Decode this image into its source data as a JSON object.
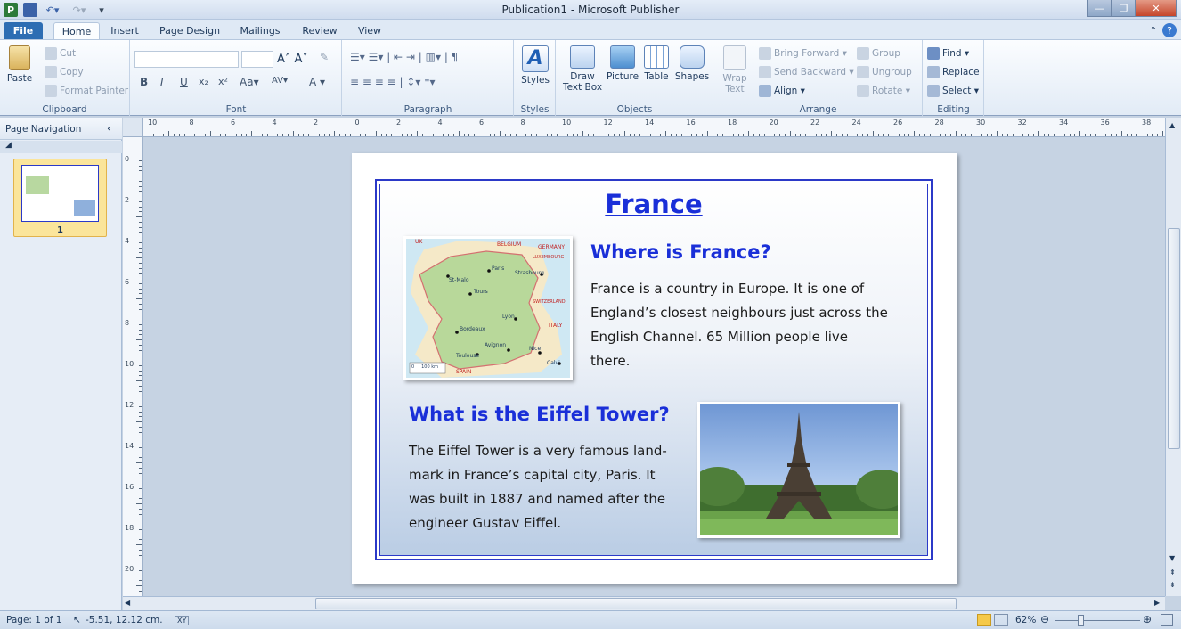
{
  "window": {
    "title": "Publication1 - Microsoft Publisher"
  },
  "tabs": [
    "File",
    "Home",
    "Insert",
    "Page Design",
    "Mailings",
    "Review",
    "View"
  ],
  "ribbon": {
    "clipboard": {
      "paste": "Paste",
      "cut": "Cut",
      "copy": "Copy",
      "format_painter": "Format Painter",
      "label": "Clipboard"
    },
    "font": {
      "label": "Font"
    },
    "paragraph": {
      "label": "Paragraph"
    },
    "styles": {
      "button": "Styles",
      "label": "Styles"
    },
    "objects": {
      "draw_text_box_1": "Draw",
      "draw_text_box_2": "Text Box",
      "picture": "Picture",
      "table": "Table",
      "shapes": "Shapes",
      "label": "Objects"
    },
    "arrange": {
      "wrap_1": "Wrap",
      "wrap_2": "Text",
      "bring_forward": "Bring Forward",
      "send_backward": "Send Backward",
      "align": "Align",
      "group": "Group",
      "ungroup": "Ungroup",
      "rotate": "Rotate",
      "label": "Arrange"
    },
    "editing": {
      "find": "Find",
      "replace": "Replace",
      "select": "Select",
      "label": "Editing"
    }
  },
  "nav": {
    "title": "Page Navigation",
    "page_number": "1"
  },
  "ruler": {
    "h_ticks": [
      "10",
      "8",
      "6",
      "4",
      "2",
      "0",
      "2",
      "4",
      "6",
      "8",
      "10",
      "12",
      "14",
      "16",
      "18",
      "20",
      "22",
      "24",
      "26",
      "28",
      "30",
      "32",
      "34",
      "36",
      "38"
    ],
    "v_ticks": [
      "0",
      "2",
      "4",
      "6",
      "8",
      "10",
      "12",
      "14",
      "16",
      "18",
      "20"
    ]
  },
  "document": {
    "title": "France",
    "heading1": "Where is France?",
    "paragraph1": [
      "France is a country in Europe. It is  one of",
      "England’s closest neighbours just across the",
      "English Channel. 65 Million people live",
      "there."
    ],
    "heading2": "What is the Eiffel Tower?",
    "paragraph2": [
      "The Eiffel Tower is a very famous land-",
      "mark in France’s capital city, Paris. It",
      "was built in 1887 and named after the",
      "engineer Gustav Eiffel."
    ],
    "map_labels": {
      "uk": "UK",
      "belgium": "BELGIUM",
      "germany": "GERMANY",
      "luxembourg": "LUXEMBOURG",
      "paris": "Paris",
      "strasbourg": "Strasbourg",
      "st_malo": "St-Malo",
      "tours": "Tours",
      "switzerland": "SWITZERLAND",
      "lyon": "Lyon",
      "italy": "ITALY",
      "bordeaux": "Bordeaux",
      "avignon": "Avignon",
      "nice": "Nice",
      "toulouse": "Toulouse",
      "calvi": "Calvi",
      "spain": "SPAIN",
      "scale": "0     100 km"
    }
  },
  "status": {
    "page": "Page: 1 of 1",
    "position": "-5.51, 12.12 cm.",
    "zoom": "62%"
  },
  "colors": {
    "heading": "#1a2fd8",
    "file_tab": "#2d6db3"
  }
}
